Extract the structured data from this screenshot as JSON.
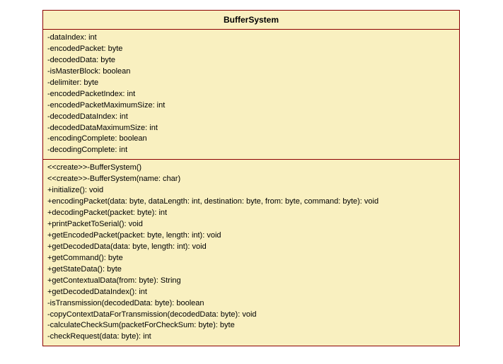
{
  "class_name": "BufferSystem",
  "attributes": [
    "-dataIndex: int",
    "-encodedPacket: byte",
    "-decodedData: byte",
    "-isMasterBlock: boolean",
    "-delimiter: byte",
    "-encodedPacketIndex: int",
    "-encodedPacketMaximumSize: int",
    "-decodedDataIndex: int",
    "-decodedDataMaximumSize: int",
    "-encodingComplete: boolean",
    "-decodingComplete: int"
  ],
  "operations": [
    "<<create>>-BufferSystem()",
    "<<create>>-BufferSystem(name: char)",
    "+initialize(): void",
    "+encodingPacket(data: byte, dataLength: int, destination: byte, from: byte, command: byte): void",
    "+decodingPacket(packet: byte): int",
    "+printPacketToSerial(): void",
    "+getEncodedPacket(packet: byte, length: int): void",
    "+getDecodedData(data: byte, length: int): void",
    "+getCommand(): byte",
    "+getStateData(): byte",
    "+getContextualData(from: byte): String",
    "+getDecodedDataIndex(): int",
    "-isTransmission(decodedData: byte): boolean",
    "-copyContextDataForTransmission(decodedData: byte): void",
    "-calculateCheckSum(packetForCheckSum: byte): byte",
    "-checkRequest(data: byte): int"
  ]
}
